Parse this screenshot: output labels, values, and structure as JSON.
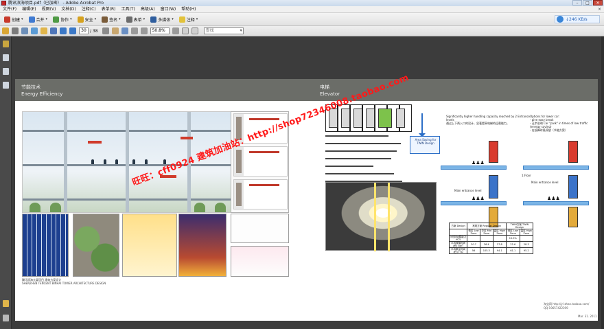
{
  "window": {
    "title": "腾讯滨海项目.pdf（已加密） - Adobe Acrobat Pro",
    "minimize": "–",
    "maximize": "□",
    "close": "✕"
  },
  "menu": {
    "items": [
      "文件(F)",
      "编辑(E)",
      "视图(V)",
      "文档(D)",
      "注释(C)",
      "表单(R)",
      "工具(T)",
      "高级(A)",
      "窗口(W)",
      "帮助(H)"
    ],
    "close": "×"
  },
  "toolbar": {
    "create": "创建",
    "combine": "合并",
    "collaborate": "协作",
    "secure": "安全",
    "sign": "签名",
    "forms": "表单",
    "multimedia": "多媒体",
    "comment": "注释",
    "net_speed": "↓246 KB/s"
  },
  "toolbar2": {
    "page_current": "30",
    "page_total": "/ 38",
    "zoom": "50.8%",
    "search_placeholder": "查找"
  },
  "page": {
    "left_title_cn": "节能技术",
    "left_title_en": "Energy Efficiency",
    "right_title_cn": "电梯",
    "right_title_en": "Elevator",
    "left_caption_1": "腾讯滨海大厦项目 建筑方案设计",
    "left_caption_2": "SHENZHEN TENCENT BINHAI TOWER ARCHITECTURE DESIGN",
    "twin_label": "Area Saving for TWIN Design",
    "capacity_note_1": "Significantly higher handling capacity reached by 2 Entrance",
    "capacity_note_2": "levels",
    "capacity_note_3": "通过上下两入口的设计，显著提高电梯的运载能力。",
    "options_note_1": "Options for lower car:",
    "options_note_2": "- give easy break",
    "options_note_3": "- 让步说明  Car \"park\" in times of low traffic",
    "options_note_4": "(energy saving)",
    "options_note_5": "- 在低峰时段停放（节能方案）",
    "floor_1": "1.Floor",
    "main_entrance_1": "Main entrance level",
    "main_entrance_2": "Main entrance level",
    "page_num": "Mar. 31. 2011",
    "right_watermark_1": "淘宝网 http://yi-zhan.taobao.com/",
    "right_watermark_2": "QQ:19657422399"
  },
  "elevator_table": {
    "headers": [
      "方案\nDesign",
      "常规方案\nRegular Design",
      "TWIN方案\nTWIN Design"
    ],
    "zones": [
      "低区\nLow Zone",
      "中区\nMid Zone",
      "高区\nHigh Zone",
      "低区\nLow Zone",
      "高区\nHigh Zone"
    ],
    "row1_label": "5分钟运载能力 HC5",
    "row1": [
      "",
      "",
      "",
      "15.9%",
      ""
    ],
    "row2_label": "平均候梯时间(秒) AWT",
    "row2": [
      "20.7",
      "26.4",
      "27.8",
      "22.6",
      "28.3"
    ],
    "row3_label": "平均乘坐时间(秒) TTD",
    "row3": [
      "56",
      "105.3",
      "94.1",
      "61.1",
      "95.2"
    ]
  },
  "overlay_text": "旺旺：cff0924  建筑加油站：http://shop72346008.taobao.com",
  "colors": {
    "band": "#6b6d68",
    "watermark": "#ff1a1a",
    "accent_blue": "#2c6fc7",
    "accent_green": "#7dc24b"
  }
}
